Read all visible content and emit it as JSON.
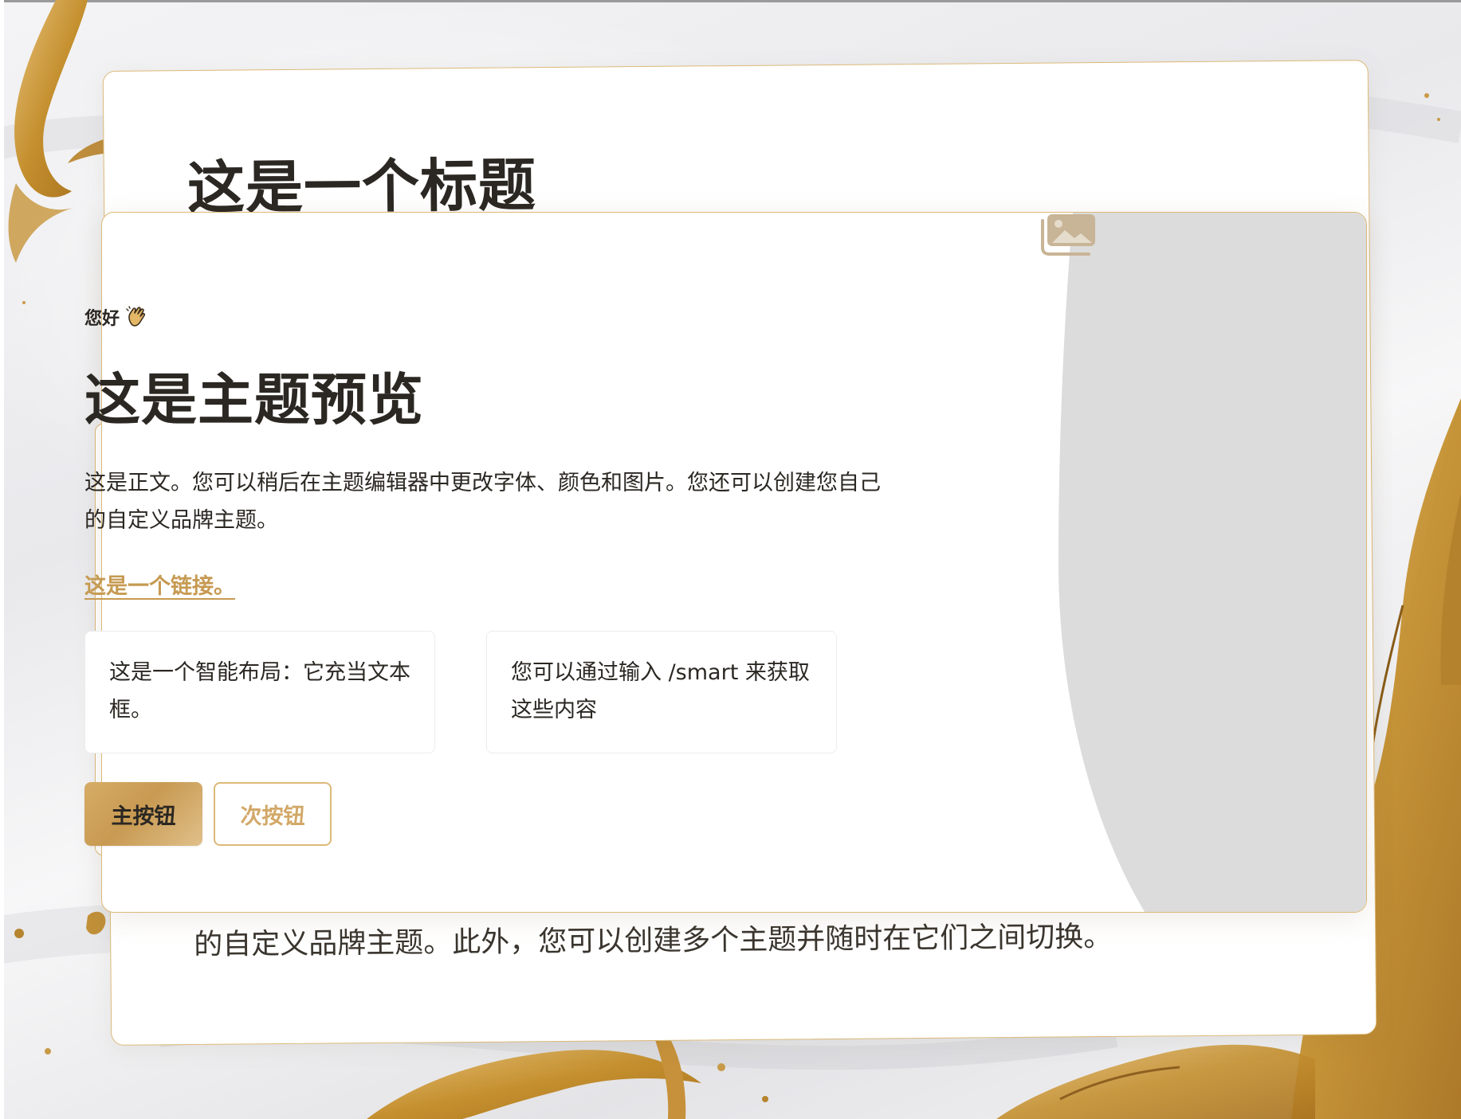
{
  "background": {
    "base_color": "#ececee",
    "accent_gold": "#c9962e"
  },
  "back_card": {
    "title": "这是一个标题",
    "body_visible_line": "的自定义品牌主题。此外，您可以创建多个主题并随时在它们之间切换。"
  },
  "preview_card": {
    "greeting": "您好",
    "greeting_icon": "waving-hand-icon",
    "title": "这是主题预览",
    "body": "这是正文。您可以稍后在主题编辑器中更改字体、颜色和图片。您还可以创建您自己的自定义品牌主题。",
    "link_label": "这是一个链接。",
    "smart_layout": [
      {
        "text": "这是一个智能布局：它充当文本框。"
      },
      {
        "text": "您可以通过输入 /smart 来获取这些内容"
      }
    ],
    "primary_button_label": "主按钮",
    "secondary_button_label": "次按钮",
    "image_placeholder_icon": "image-placeholder-icon"
  },
  "colors": {
    "accent": "#c69a52",
    "border": "#dcb978",
    "text": "#2b2722",
    "placeholder_gray": "#dcdcdc"
  }
}
